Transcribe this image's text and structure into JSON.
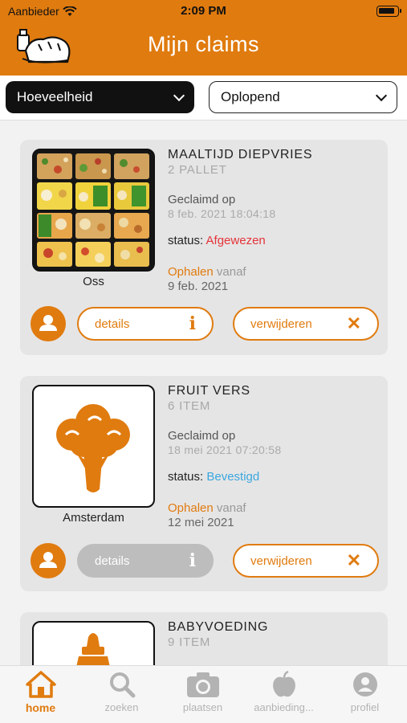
{
  "status_bar": {
    "carrier": "Aanbieder",
    "time": "2:09 PM"
  },
  "header": {
    "title": "Mijn claims",
    "logo_icon": "bread-logo"
  },
  "filters": {
    "sort_field": "Hoeveelheid",
    "sort_order": "Oplopend"
  },
  "labels": {
    "claimed_on": "Geclaimd op",
    "status": "status:",
    "pickup": "Ophalen",
    "from": "vanaf",
    "details": "details",
    "remove": "verwijderen",
    "info_glyph": "i",
    "remove_glyph": "✕"
  },
  "claims": [
    {
      "name": "MAALTIJD DIEPVRIES",
      "quantity": "2 PALLET",
      "claimed_date": "8 feb. 2021 18:04:18",
      "status": "Afgewezen",
      "status_color": "#e3343a",
      "pickup_date": "9 feb. 2021",
      "city": "Oss",
      "details_enabled": true
    },
    {
      "name": "FRUIT VERS",
      "quantity": "6 ITEM",
      "claimed_date": "18 mei 2021 07:20:58",
      "status": "Bevestigd",
      "status_color": "#3aa7df",
      "pickup_date": "12 mei 2021",
      "city": "Amsterdam",
      "details_enabled": false
    },
    {
      "name": "BABYVOEDING",
      "quantity": "9 ITEM",
      "city": ""
    }
  ],
  "tabs": [
    {
      "label": "home",
      "icon": "house-icon",
      "active": true
    },
    {
      "label": "zoeken",
      "icon": "search-icon",
      "active": false
    },
    {
      "label": "plaatsen",
      "icon": "camera-icon",
      "active": false
    },
    {
      "label": "aanbieding...",
      "icon": "apple-icon",
      "active": false
    },
    {
      "label": "profiel",
      "icon": "profile-icon",
      "active": false
    }
  ],
  "colors": {
    "accent": "#e07b0f",
    "card": "#e6e5e5",
    "disabled": "#bdbdbd"
  }
}
